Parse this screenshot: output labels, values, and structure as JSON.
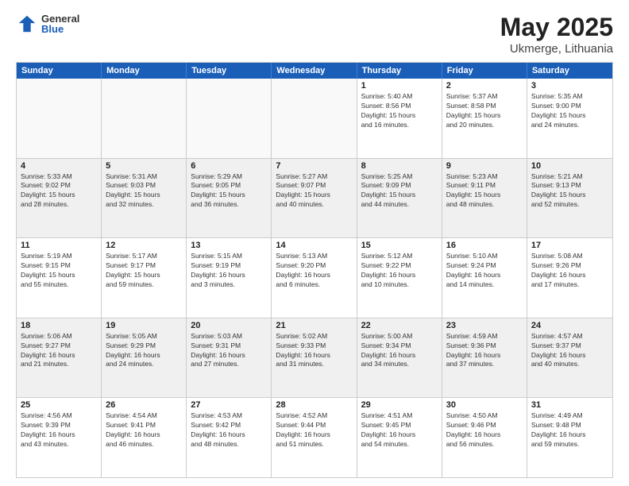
{
  "logo": {
    "general": "General",
    "blue": "Blue"
  },
  "title": "May 2025",
  "subtitle": "Ukmerge, Lithuania",
  "weekdays": [
    "Sunday",
    "Monday",
    "Tuesday",
    "Wednesday",
    "Thursday",
    "Friday",
    "Saturday"
  ],
  "rows": [
    [
      {
        "day": "",
        "info": ""
      },
      {
        "day": "",
        "info": ""
      },
      {
        "day": "",
        "info": ""
      },
      {
        "day": "",
        "info": ""
      },
      {
        "day": "1",
        "info": "Sunrise: 5:40 AM\nSunset: 8:56 PM\nDaylight: 15 hours\nand 16 minutes."
      },
      {
        "day": "2",
        "info": "Sunrise: 5:37 AM\nSunset: 8:58 PM\nDaylight: 15 hours\nand 20 minutes."
      },
      {
        "day": "3",
        "info": "Sunrise: 5:35 AM\nSunset: 9:00 PM\nDaylight: 15 hours\nand 24 minutes."
      }
    ],
    [
      {
        "day": "4",
        "info": "Sunrise: 5:33 AM\nSunset: 9:02 PM\nDaylight: 15 hours\nand 28 minutes."
      },
      {
        "day": "5",
        "info": "Sunrise: 5:31 AM\nSunset: 9:03 PM\nDaylight: 15 hours\nand 32 minutes."
      },
      {
        "day": "6",
        "info": "Sunrise: 5:29 AM\nSunset: 9:05 PM\nDaylight: 15 hours\nand 36 minutes."
      },
      {
        "day": "7",
        "info": "Sunrise: 5:27 AM\nSunset: 9:07 PM\nDaylight: 15 hours\nand 40 minutes."
      },
      {
        "day": "8",
        "info": "Sunrise: 5:25 AM\nSunset: 9:09 PM\nDaylight: 15 hours\nand 44 minutes."
      },
      {
        "day": "9",
        "info": "Sunrise: 5:23 AM\nSunset: 9:11 PM\nDaylight: 15 hours\nand 48 minutes."
      },
      {
        "day": "10",
        "info": "Sunrise: 5:21 AM\nSunset: 9:13 PM\nDaylight: 15 hours\nand 52 minutes."
      }
    ],
    [
      {
        "day": "11",
        "info": "Sunrise: 5:19 AM\nSunset: 9:15 PM\nDaylight: 15 hours\nand 55 minutes."
      },
      {
        "day": "12",
        "info": "Sunrise: 5:17 AM\nSunset: 9:17 PM\nDaylight: 15 hours\nand 59 minutes."
      },
      {
        "day": "13",
        "info": "Sunrise: 5:15 AM\nSunset: 9:19 PM\nDaylight: 16 hours\nand 3 minutes."
      },
      {
        "day": "14",
        "info": "Sunrise: 5:13 AM\nSunset: 9:20 PM\nDaylight: 16 hours\nand 6 minutes."
      },
      {
        "day": "15",
        "info": "Sunrise: 5:12 AM\nSunset: 9:22 PM\nDaylight: 16 hours\nand 10 minutes."
      },
      {
        "day": "16",
        "info": "Sunrise: 5:10 AM\nSunset: 9:24 PM\nDaylight: 16 hours\nand 14 minutes."
      },
      {
        "day": "17",
        "info": "Sunrise: 5:08 AM\nSunset: 9:26 PM\nDaylight: 16 hours\nand 17 minutes."
      }
    ],
    [
      {
        "day": "18",
        "info": "Sunrise: 5:06 AM\nSunset: 9:27 PM\nDaylight: 16 hours\nand 21 minutes."
      },
      {
        "day": "19",
        "info": "Sunrise: 5:05 AM\nSunset: 9:29 PM\nDaylight: 16 hours\nand 24 minutes."
      },
      {
        "day": "20",
        "info": "Sunrise: 5:03 AM\nSunset: 9:31 PM\nDaylight: 16 hours\nand 27 minutes."
      },
      {
        "day": "21",
        "info": "Sunrise: 5:02 AM\nSunset: 9:33 PM\nDaylight: 16 hours\nand 31 minutes."
      },
      {
        "day": "22",
        "info": "Sunrise: 5:00 AM\nSunset: 9:34 PM\nDaylight: 16 hours\nand 34 minutes."
      },
      {
        "day": "23",
        "info": "Sunrise: 4:59 AM\nSunset: 9:36 PM\nDaylight: 16 hours\nand 37 minutes."
      },
      {
        "day": "24",
        "info": "Sunrise: 4:57 AM\nSunset: 9:37 PM\nDaylight: 16 hours\nand 40 minutes."
      }
    ],
    [
      {
        "day": "25",
        "info": "Sunrise: 4:56 AM\nSunset: 9:39 PM\nDaylight: 16 hours\nand 43 minutes."
      },
      {
        "day": "26",
        "info": "Sunrise: 4:54 AM\nSunset: 9:41 PM\nDaylight: 16 hours\nand 46 minutes."
      },
      {
        "day": "27",
        "info": "Sunrise: 4:53 AM\nSunset: 9:42 PM\nDaylight: 16 hours\nand 48 minutes."
      },
      {
        "day": "28",
        "info": "Sunrise: 4:52 AM\nSunset: 9:44 PM\nDaylight: 16 hours\nand 51 minutes."
      },
      {
        "day": "29",
        "info": "Sunrise: 4:51 AM\nSunset: 9:45 PM\nDaylight: 16 hours\nand 54 minutes."
      },
      {
        "day": "30",
        "info": "Sunrise: 4:50 AM\nSunset: 9:46 PM\nDaylight: 16 hours\nand 56 minutes."
      },
      {
        "day": "31",
        "info": "Sunrise: 4:49 AM\nSunset: 9:48 PM\nDaylight: 16 hours\nand 59 minutes."
      }
    ]
  ]
}
